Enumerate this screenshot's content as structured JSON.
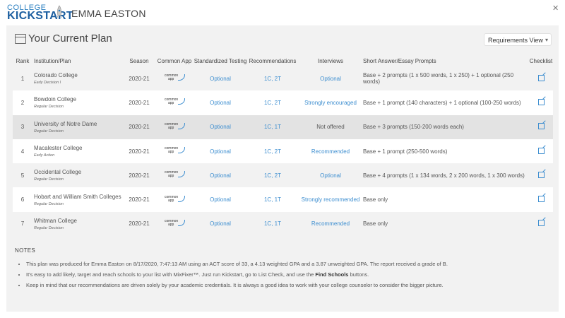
{
  "app": {
    "logo_top": "COLLEGE",
    "logo_bottom": "KICKSTART",
    "student_name": "EMMA EASTON",
    "close_icon": "close-icon",
    "accent": "#3d8ed0"
  },
  "panel": {
    "title": "Your Current Plan",
    "view_select": "Requirements View",
    "columns": [
      "Rank",
      "Institution/Plan",
      "Season",
      "Common App",
      "Standardized Testing",
      "Recommendations",
      "Interviews",
      "Short Answer/Essay Prompts",
      "Checklist"
    ],
    "rows": [
      {
        "rank": "1",
        "name": "Colorado College",
        "plan": "Early Decision I",
        "season": "2020-21",
        "capp1": "common",
        "capp2": "app",
        "testing": "Optional",
        "recs": "1C, 2T",
        "interviews": "Optional",
        "interviews_link": true,
        "essays": "Base + 2 prompts (1 x 500 words, 1 x 250) + 1 optional (250 words)"
      },
      {
        "rank": "2",
        "name": "Bowdoin College",
        "plan": "Regular Decision",
        "season": "2020-21",
        "capp1": "common",
        "capp2": "app",
        "testing": "Optional",
        "recs": "1C, 2T",
        "interviews": "Strongly encouraged",
        "interviews_link": true,
        "essays": "Base + 1 prompt (140 characters) + 1 optional (100-250 words)"
      },
      {
        "rank": "3",
        "name": "University of Notre Dame",
        "plan": "Regular Decision",
        "season": "2020-21",
        "capp1": "common",
        "capp2": "app",
        "testing": "Optional",
        "recs": "1C, 1T",
        "interviews": "Not offered",
        "interviews_link": false,
        "essays": "Base + 3 prompts (150-200 words each)"
      },
      {
        "rank": "4",
        "name": "Macalester College",
        "plan": "Early Action",
        "season": "2020-21",
        "capp1": "common",
        "capp2": "app",
        "testing": "Optional",
        "recs": "1C, 2T",
        "interviews": "Recommended",
        "interviews_link": true,
        "essays": "Base + 1 prompt (250-500 words)"
      },
      {
        "rank": "5",
        "name": "Occidental College",
        "plan": "Regular Decision",
        "season": "2020-21",
        "capp1": "common",
        "capp2": "app",
        "testing": "Optional",
        "recs": "1C, 2T",
        "interviews": "Optional",
        "interviews_link": true,
        "essays": "Base + 4 prompts (1 x 134 words, 2 x 200 words, 1 x 300 words)"
      },
      {
        "rank": "6",
        "name": "Hobart and William Smith Colleges",
        "plan": "Regular Decision",
        "season": "2020-21",
        "capp1": "common",
        "capp2": "app",
        "testing": "Optional",
        "recs": "1C, 1T",
        "interviews": "Strongly recommended",
        "interviews_link": true,
        "essays": "Base only"
      },
      {
        "rank": "7",
        "name": "Whitman College",
        "plan": "Regular Decision",
        "season": "2020-21",
        "capp1": "common",
        "capp2": "app",
        "testing": "Optional",
        "recs": "1C, 1T",
        "interviews": "Recommended",
        "interviews_link": true,
        "essays": "Base only"
      }
    ]
  },
  "notes": {
    "label": "NOTES",
    "items": [
      {
        "text": "This plan was produced for Emma Easton on 8/17/2020, 7:47:13 AM using an ACT score of 33, a 4.13 weighted GPA and a 3.87 unweighted GPA. The report received a grade of B."
      },
      {
        "before": "It's easy to add likely, target and reach schools to your list with MixFixer™. Just run Kickstart, go to List Check, and use the ",
        "bold": "Find Schools",
        "after": " buttons."
      },
      {
        "text": "Keep in mind that our recommendations are driven solely by your academic credentials. It is always a good idea to work with your college counselor to consider the bigger picture."
      }
    ]
  }
}
